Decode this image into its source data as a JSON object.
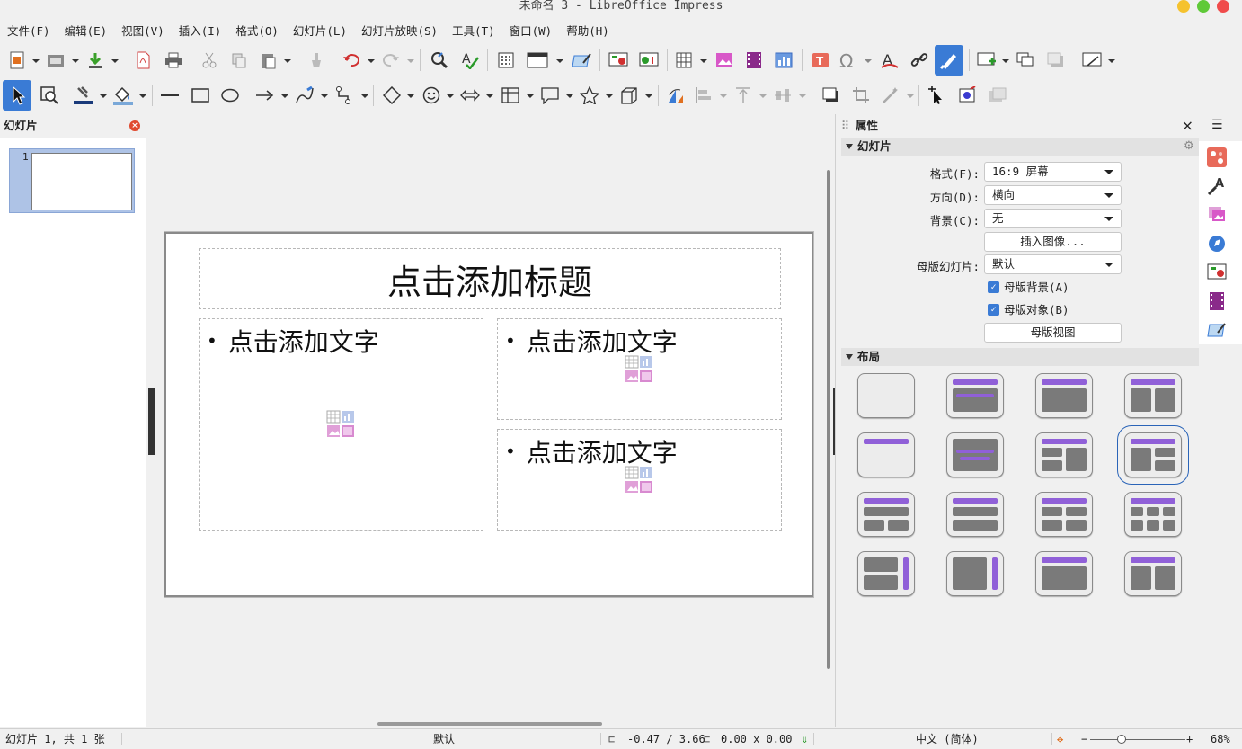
{
  "window": {
    "title": "未命名 3 - LibreOffice Impress",
    "controls_colors": {
      "minimize": "#f5c22e",
      "maximize": "#5fc938",
      "close": "#f04b4b"
    }
  },
  "menu": [
    "文件(F)",
    "编辑(E)",
    "视图(V)",
    "插入(I)",
    "格式(O)",
    "幻灯片(L)",
    "幻灯片放映(S)",
    "工具(T)",
    "窗口(W)",
    "帮助(H)"
  ],
  "slides_panel": {
    "title": "幻灯片",
    "slide_number": "1"
  },
  "slide": {
    "title_placeholder": "点击添加标题",
    "text_placeholder_1": "点击添加文字",
    "text_placeholder_2": "点击添加文字",
    "text_placeholder_3": "点击添加文字",
    "bullet": "•"
  },
  "properties": {
    "title": "属性",
    "close": "×",
    "menu": "☰",
    "slide_section": "幻灯片",
    "format_label": "格式(F):",
    "format_value": "16:9 屏幕",
    "orientation_label": "方向(D):",
    "orientation_value": "横向",
    "background_label": "背景(C):",
    "background_value": "无",
    "insert_image_button": "插入图像...",
    "master_label": "母版幻灯片:",
    "master_value": "默认",
    "master_background": "母版背景(A)",
    "master_objects": "母版对象(B)",
    "master_view_button": "母版视图",
    "layout_section": "布局"
  },
  "status": {
    "slide_info": "幻灯片 1, 共 1 张",
    "master": "默认",
    "position": "-0.47 / 3.66",
    "size": "0.00 x 0.00",
    "language": "中文 (简体)",
    "zoom": "68%",
    "zoom_minus": "−",
    "zoom_plus": "+"
  },
  "colors": {
    "accent": "#9060d8",
    "layout_gray": "#7a7a7a",
    "selection": "#aec3e6"
  }
}
